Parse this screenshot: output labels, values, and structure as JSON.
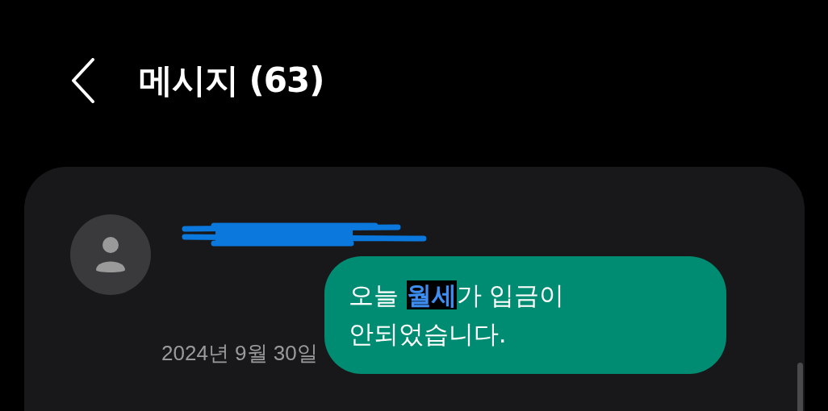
{
  "header": {
    "title": "메시지 (63)"
  },
  "conversation": {
    "sender": {
      "redacted": true
    },
    "message": {
      "parts": [
        {
          "text": "오늘 ",
          "highlighted": false
        },
        {
          "text": "월세",
          "highlighted": true
        },
        {
          "text": "가 입금이 안되었습니다.",
          "highlighted": false
        }
      ]
    },
    "date": "2024년 9월 30일"
  }
}
